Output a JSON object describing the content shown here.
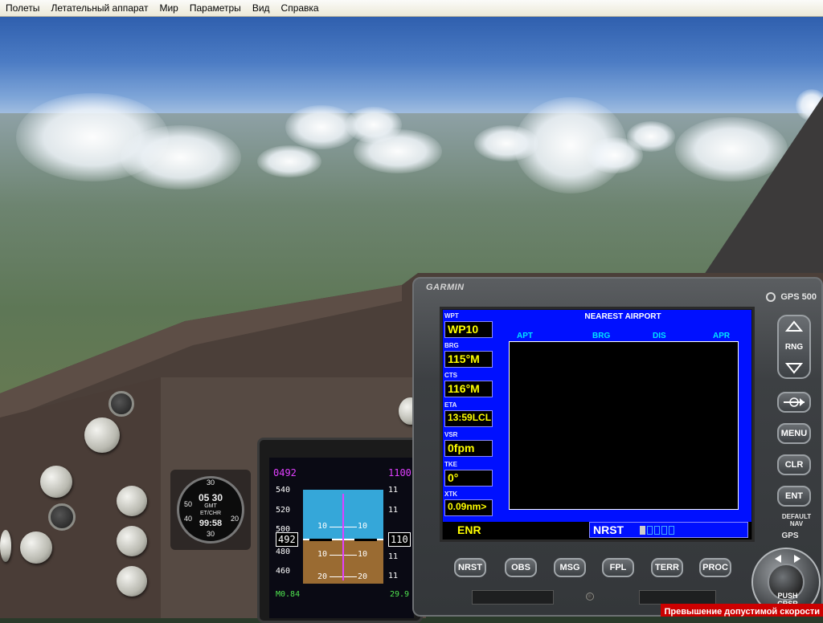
{
  "menubar": {
    "items": [
      "Полеты",
      "Летательный аппарат",
      "Мир",
      "Параметры",
      "Вид",
      "Справка"
    ]
  },
  "pfd": {
    "speed_top": "0492",
    "alt_top": "1100",
    "speed_ticks": [
      "540",
      "520",
      "500",
      "480",
      "460"
    ],
    "speed_current": "492",
    "mach": "M0.84",
    "pitch_labels": [
      "10",
      "10",
      "10",
      "10",
      "20",
      "20"
    ],
    "alt_ticks": [
      "11",
      "11",
      "11",
      "11"
    ],
    "alt_current": "110",
    "baro": "29.9"
  },
  "clock": {
    "line1": "05 30",
    "line2": "GMT",
    "line3": "ET/CHR",
    "line4": "99:58",
    "numbers": [
      "30",
      "50",
      "20",
      "40",
      "30"
    ]
  },
  "gps": {
    "brand": "GARMIN",
    "model": "GPS 500",
    "left_column": [
      {
        "label": "WPT",
        "value": "WP10"
      },
      {
        "label": "BRG",
        "value": "115°M"
      },
      {
        "label": "CTS",
        "value": "116°M"
      },
      {
        "label": "ETA",
        "value": "13:59LCL"
      },
      {
        "label": "VSR",
        "value": "0fpm"
      },
      {
        "label": "TKE",
        "value": "0°"
      },
      {
        "label": "XTK",
        "value": "0.09nm>"
      }
    ],
    "page_title": "NEAREST AIRPORT",
    "columns": [
      "APT",
      "BRG",
      "DIS",
      "APR"
    ],
    "mode": "ENR",
    "page_group": "NRST",
    "side_buttons": {
      "rng": "RNG",
      "direct_to": "-D->",
      "menu": "MENU",
      "clr": "CLR",
      "ent": "ENT",
      "default_nav": "DEFAULT\nNAV",
      "gps_label": "GPS"
    },
    "bottom_buttons": [
      "NRST",
      "OBS",
      "MSG",
      "FPL",
      "TERR",
      "PROC"
    ],
    "knob": {
      "line1": "PUSH",
      "line2": "CRSR"
    }
  },
  "status": {
    "alert": "Превышение допустимой скорости"
  },
  "colors": {
    "gps_screen_blue": "#0010ff",
    "gps_value_yellow": "#ffff00",
    "gps_heading_cyan": "#00e5ff",
    "alert_red": "#cc0000",
    "pfd_magenta": "#e040ff"
  }
}
